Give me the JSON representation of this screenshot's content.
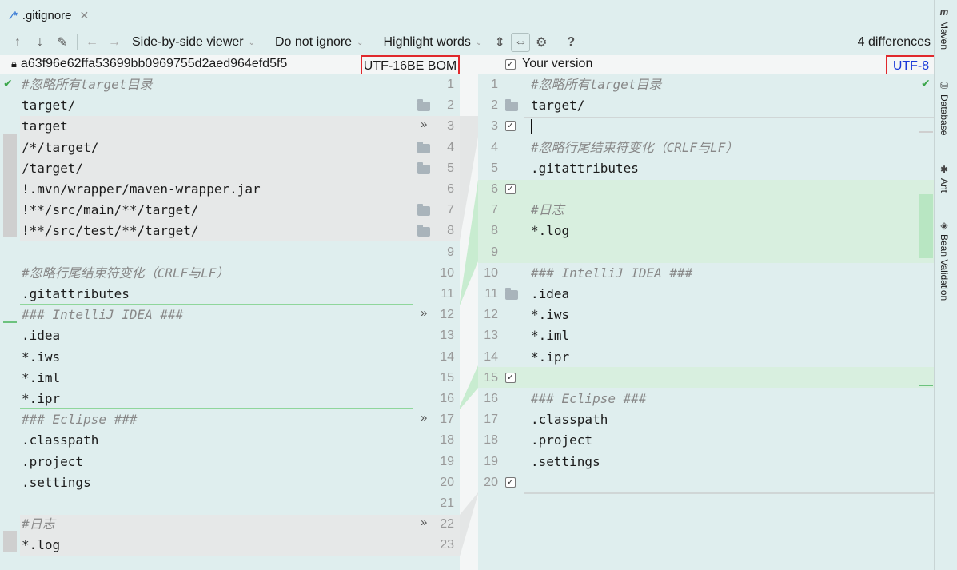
{
  "tab": {
    "title": ".gitignore",
    "close": "✕"
  },
  "toolbar": {
    "viewer": "Side-by-side viewer",
    "ignore": "Do not ignore",
    "highlight": "Highlight words",
    "differences": "4 differences"
  },
  "header": {
    "left_revision": "a63f96e62ffa53699bb0969755d2aed964efd5f5",
    "left_encoding": "UTF-16BE BOM",
    "right_title": "Your version",
    "right_encoding": "UTF-8"
  },
  "left_lines": [
    "#忽略所有target目录",
    "target/",
    "target",
    "/*/target/",
    "/target/",
    "!.mvn/wrapper/maven-wrapper.jar",
    "!**/src/main/**/target/",
    "!**/src/test/**/target/",
    "",
    "#忽略行尾结束符变化（CRLF与LF）",
    ".gitattributes",
    "### IntelliJ IDEA ###",
    ".idea",
    "*.iws",
    "*.iml",
    "*.ipr",
    "### Eclipse ###",
    ".classpath",
    ".project",
    ".settings",
    "",
    "#日志",
    "*.log"
  ],
  "left_numbers": [
    "1",
    "2",
    "3",
    "4",
    "5",
    "6",
    "7",
    "8",
    "9",
    "10",
    "11",
    "12",
    "13",
    "14",
    "15",
    "16",
    "17",
    "18",
    "19",
    "20",
    "21",
    "22",
    "23"
  ],
  "right_lines": [
    "#忽略所有target目录",
    "target/",
    "",
    "#忽略行尾结束符变化（CRLF与LF）",
    ".gitattributes",
    "",
    "#日志",
    "*.log",
    "",
    "### IntelliJ IDEA ###",
    ".idea",
    "*.iws",
    "*.iml",
    "*.ipr",
    "",
    "### Eclipse ###",
    ".classpath",
    ".project",
    ".settings",
    ""
  ],
  "right_numbers": [
    "1",
    "2",
    "3",
    "4",
    "5",
    "6",
    "7",
    "8",
    "9",
    "10",
    "11",
    "12",
    "13",
    "14",
    "15",
    "16",
    "17",
    "18",
    "19",
    "20"
  ],
  "sidebar": {
    "maven": "Maven",
    "database": "Database",
    "ant": "Ant",
    "bean_validation": "Bean Validation"
  },
  "colors": {
    "accent_red": "#e0282c",
    "link_blue": "#1a3ad8",
    "added_green": "#d8efdf",
    "changed_gray": "#e6e8e8"
  }
}
